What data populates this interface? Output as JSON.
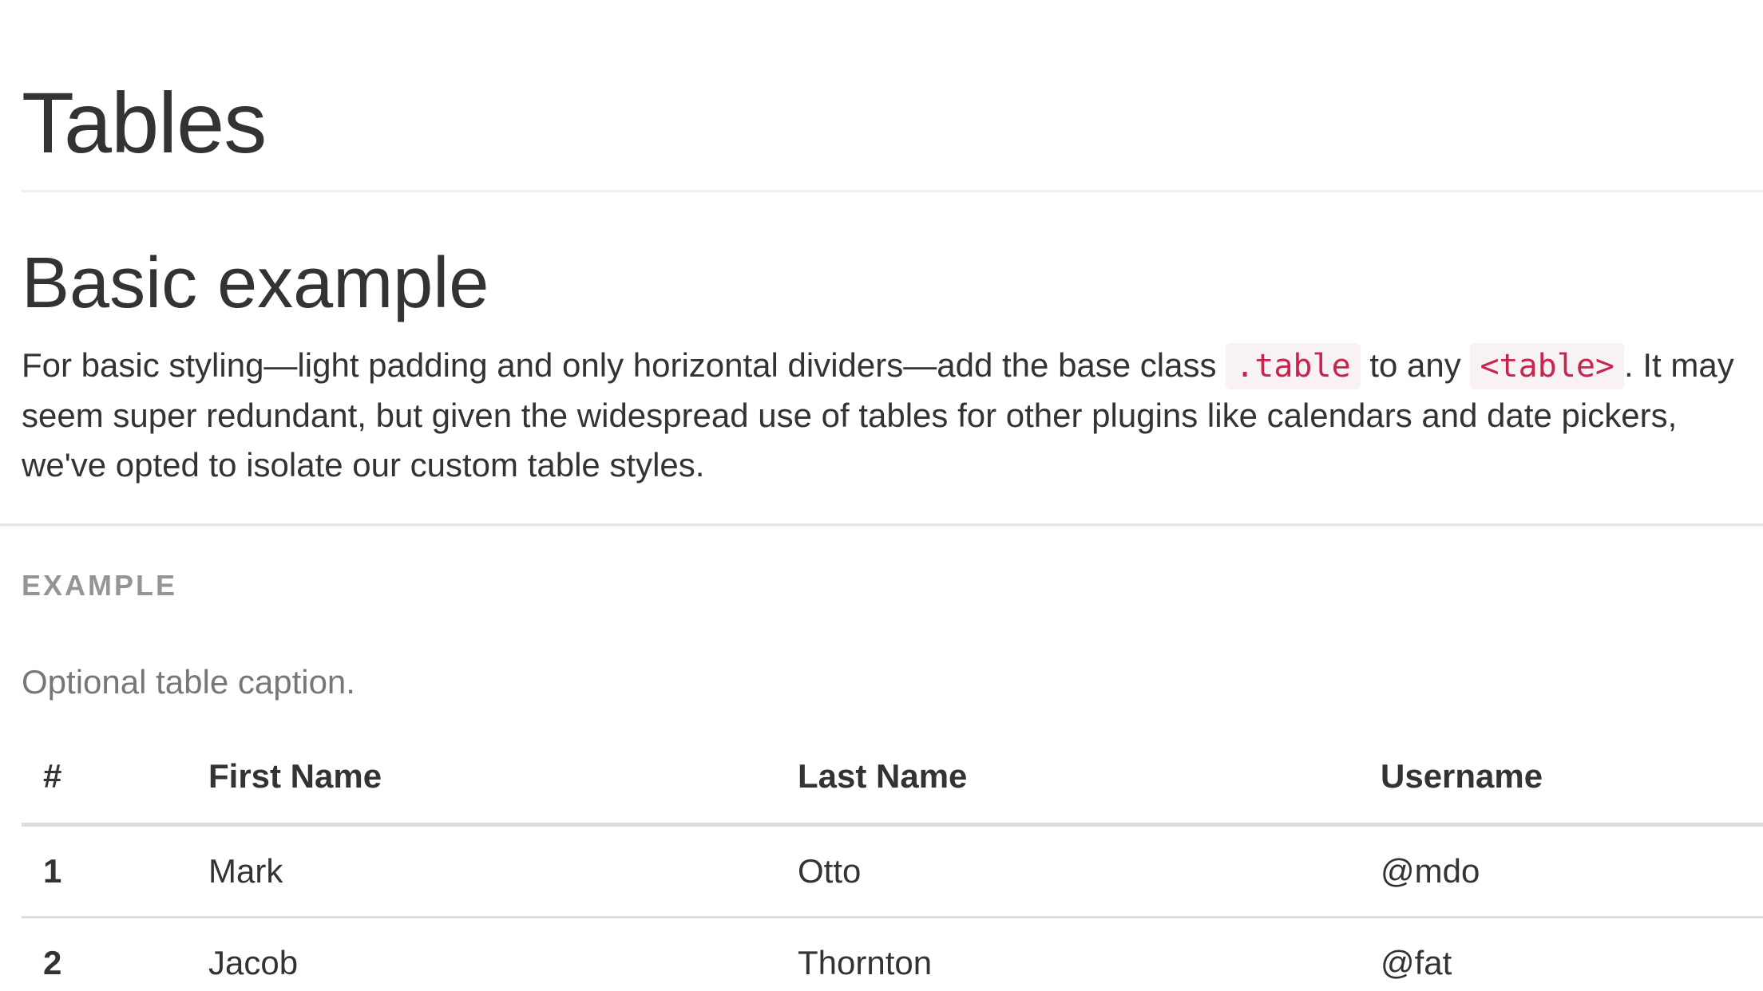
{
  "page": {
    "title": "Tables"
  },
  "section": {
    "heading": "Basic example",
    "lead_part1": "For basic styling—light padding and only horizontal dividers—add the base class ",
    "code1": ".table",
    "lead_part2": " to any ",
    "code2": "<table>",
    "lead_part3": ". It may seem super redundant, but given the widespread use of tables for other plugins like calendars and date pickers, we've opted to isolate our custom table styles."
  },
  "example": {
    "label": "EXAMPLE",
    "caption": "Optional table caption.",
    "table": {
      "headers": [
        "#",
        "First Name",
        "Last Name",
        "Username"
      ],
      "rows": [
        [
          "1",
          "Mark",
          "Otto",
          "@mdo"
        ],
        [
          "2",
          "Jacob",
          "Thornton",
          "@fat"
        ]
      ]
    }
  },
  "colors": {
    "text": "#333333",
    "code_text": "#c7254e",
    "code_bg": "#f9f2f4",
    "label": "#959595",
    "caption": "#777777",
    "divider": "#dddddd"
  }
}
